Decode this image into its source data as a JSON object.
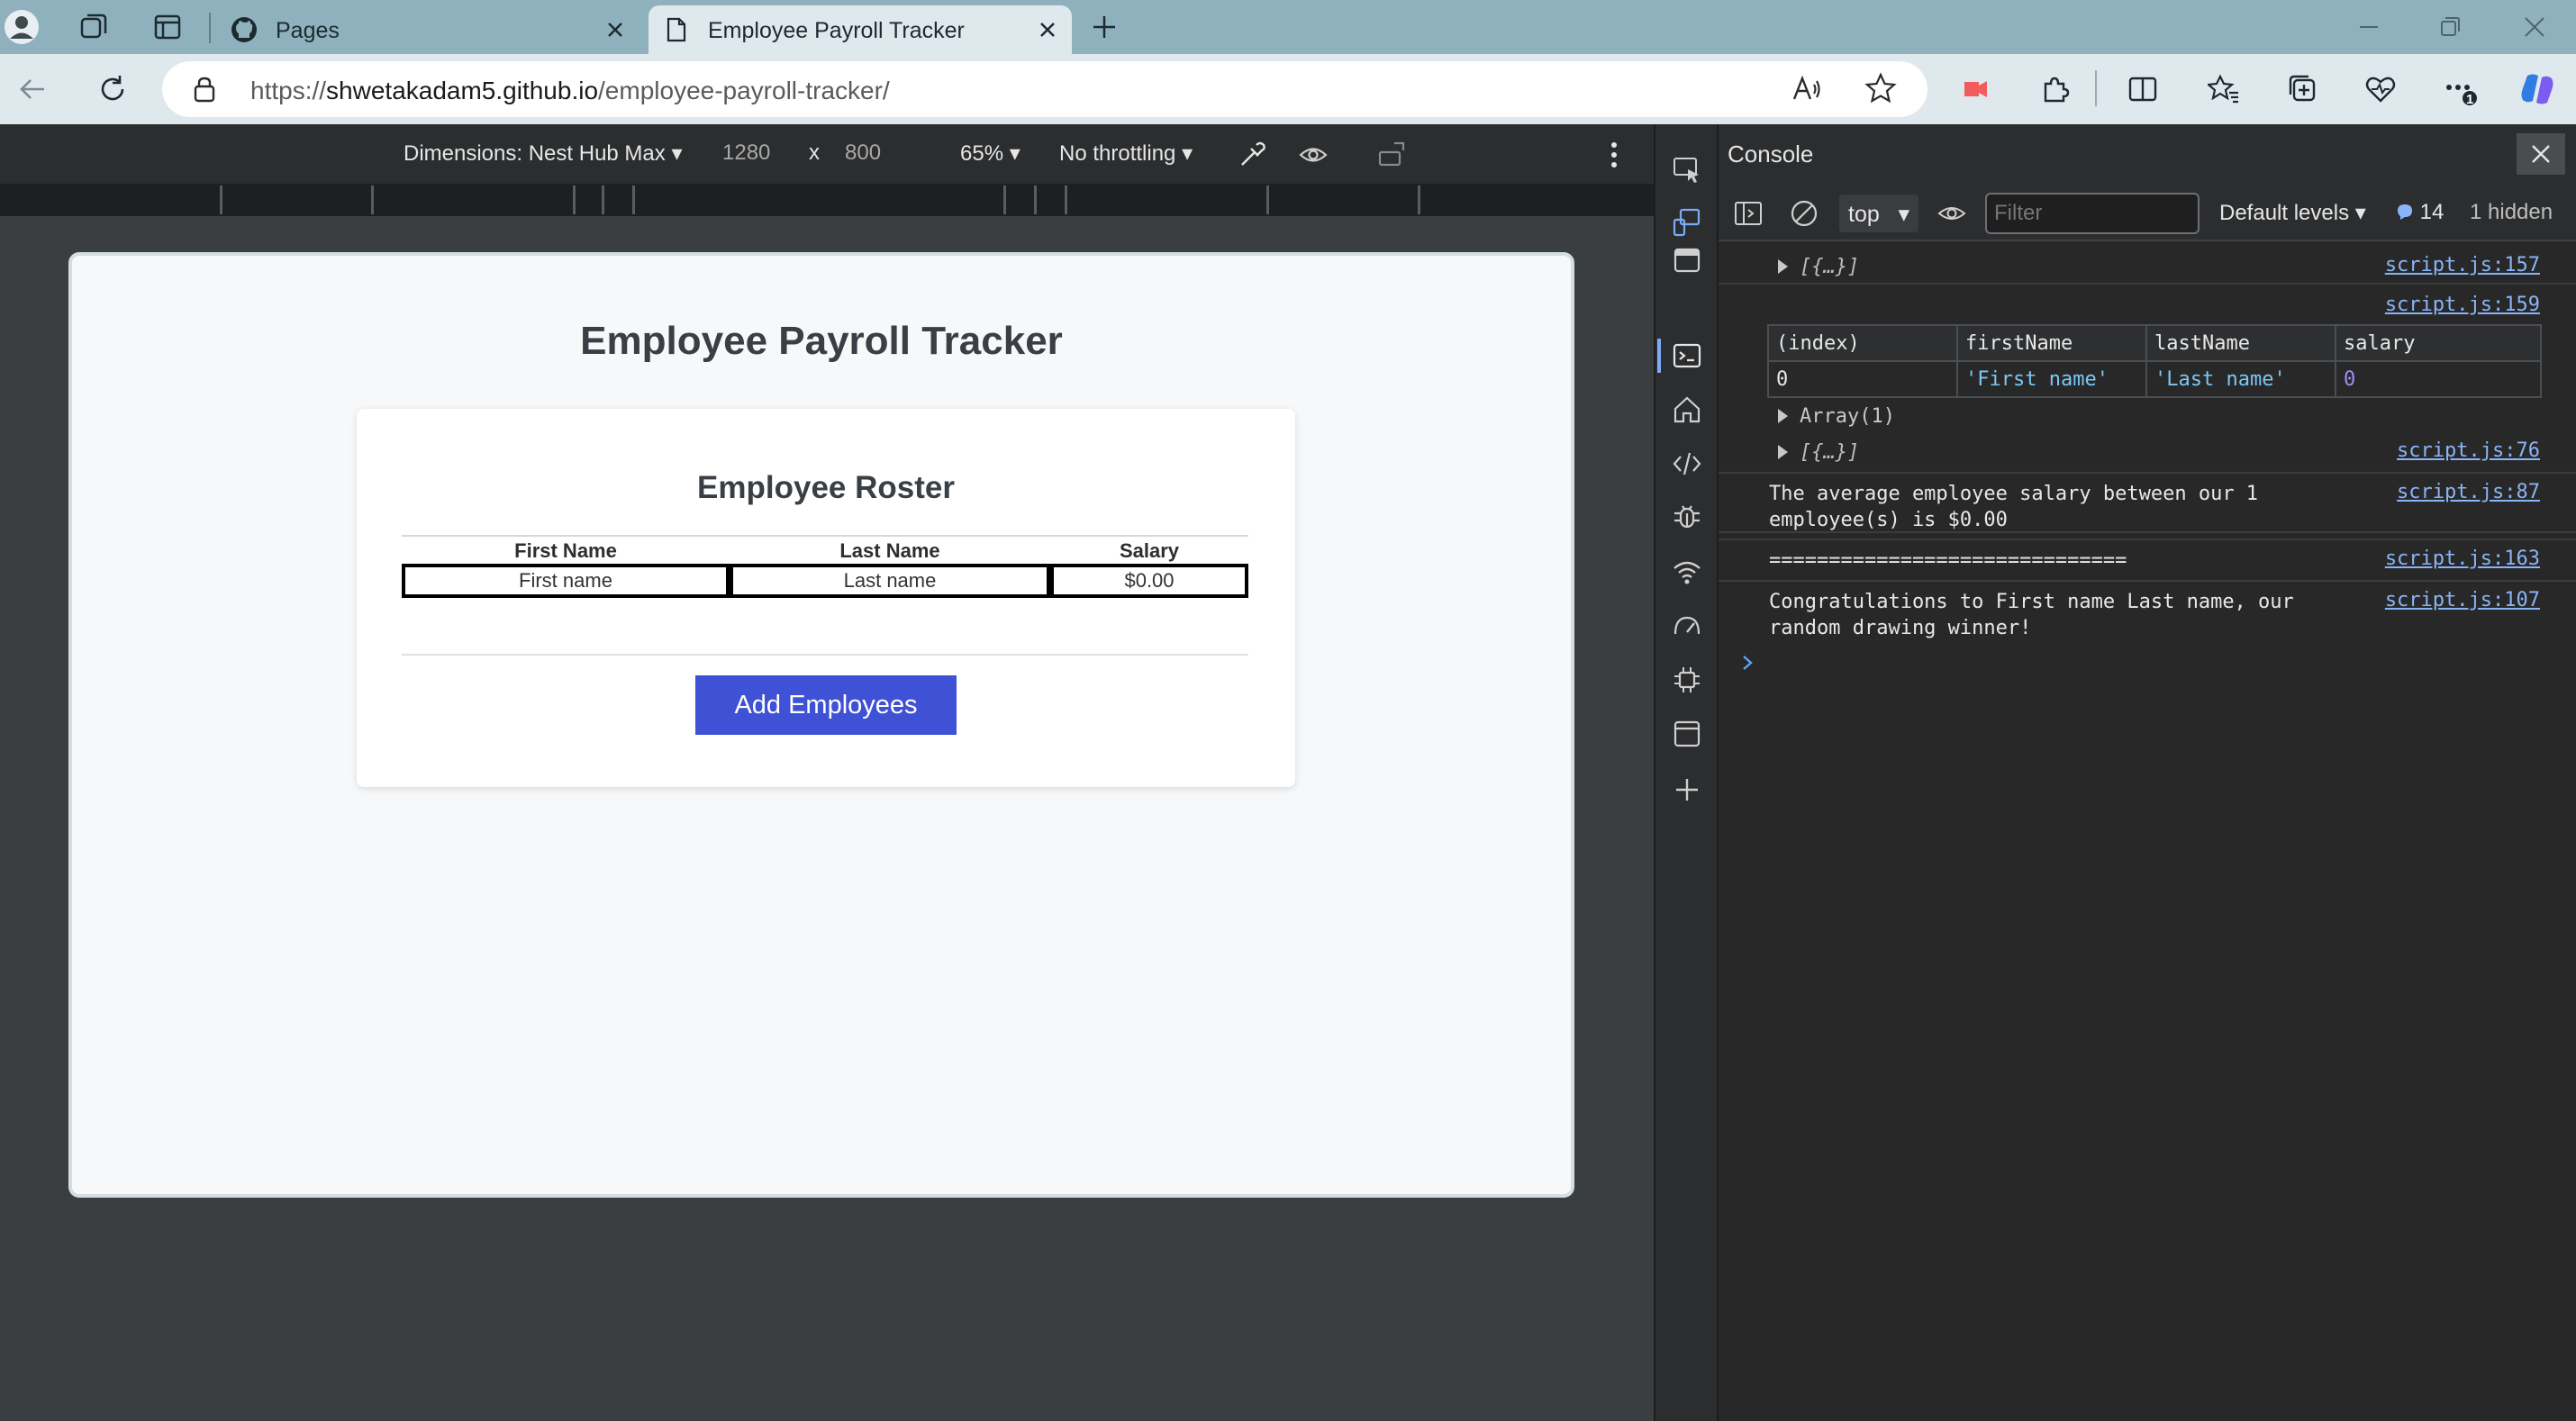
{
  "browser": {
    "tabs": [
      {
        "label": "Pages",
        "favicon": "github-icon",
        "active": false
      },
      {
        "label": "Employee Payroll Tracker",
        "favicon": "page-icon",
        "active": true
      }
    ],
    "url": {
      "protocol": "https://",
      "host": "shwetakadam5.github.io",
      "path": "/employee-payroll-tracker/"
    },
    "toolbar_badge": "1"
  },
  "device_toolbar": {
    "dimensions_label": "Dimensions: Nest Hub Max",
    "width": "1280",
    "times": "x",
    "height": "800",
    "zoom": "65%",
    "throttling": "No throttling"
  },
  "page": {
    "title": "Employee Payroll Tracker",
    "card_title": "Employee Roster",
    "table": {
      "headers": [
        "First Name",
        "Last Name",
        "Salary"
      ],
      "rows": [
        [
          "First name",
          "Last name",
          "$0.00"
        ]
      ]
    },
    "add_button": "Add Employees"
  },
  "console": {
    "title": "Console",
    "context": "top",
    "filter_placeholder": "Filter",
    "levels": "Default levels",
    "message_count": "14",
    "hidden": "1 hidden",
    "entries": [
      {
        "text": "[{…}]",
        "source": "script.js:157"
      },
      {
        "source": "script.js:159"
      },
      {
        "text": "Array(1)"
      },
      {
        "text": "[{…}]",
        "source": "script.js:76"
      },
      {
        "text": "The average employee salary between our 1\nemployee(s) is $0.00",
        "source": "script.js:87"
      },
      {
        "text": "==============================",
        "source": "script.js:163"
      },
      {
        "text": "Congratulations to First name Last name, our\nrandom drawing winner!",
        "source": "script.js:107"
      }
    ],
    "table": {
      "headers": [
        "(index)",
        "firstName",
        "lastName",
        "salary"
      ],
      "rows": [
        [
          "0",
          "'First name'",
          "'Last name'",
          "0"
        ]
      ]
    }
  },
  "colors": {
    "titlebar": "#8fb1bd",
    "accent_button": "#3f51d4",
    "console_link": "#8ab4f8"
  }
}
